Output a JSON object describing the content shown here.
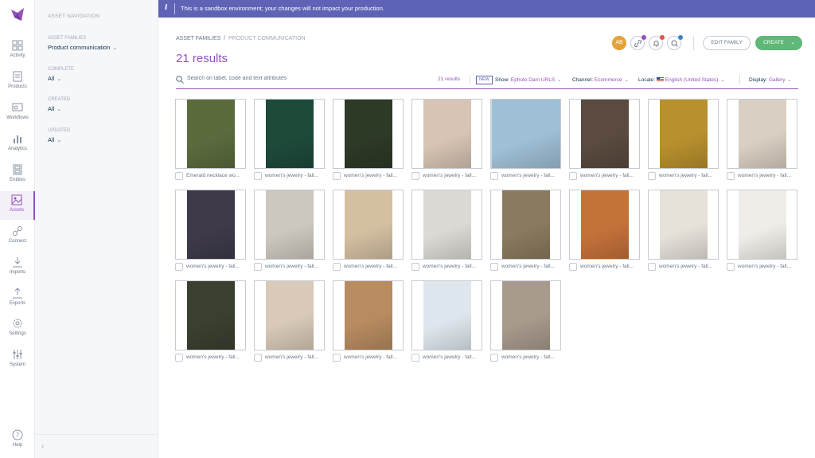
{
  "banner": {
    "text": "This is a sandbox environment; your changes will not impact your production."
  },
  "mainnav": {
    "items": [
      {
        "label": "Activity",
        "icon": "activity-icon"
      },
      {
        "label": "Products",
        "icon": "products-icon"
      },
      {
        "label": "Workflows",
        "icon": "workflows-icon"
      },
      {
        "label": "Analytics",
        "icon": "analytics-icon"
      },
      {
        "label": "Entities",
        "icon": "entities-icon"
      },
      {
        "label": "Assets",
        "icon": "assets-icon",
        "active": true
      },
      {
        "label": "Connect",
        "icon": "connect-icon"
      },
      {
        "label": "Imports",
        "icon": "imports-icon"
      },
      {
        "label": "Exports",
        "icon": "exports-icon"
      },
      {
        "label": "Settings",
        "icon": "settings-icon"
      },
      {
        "label": "System",
        "icon": "system-icon"
      }
    ],
    "help": "Help"
  },
  "subnav": {
    "title": "ASSET NAVIGATION",
    "family_label": "ASSET FAMILIES",
    "family_value": "Product communication",
    "complete_label": "COMPLETE",
    "complete_value": "All",
    "created_label": "CREATED",
    "created_value": "All",
    "updated_label": "UPDATED",
    "updated_value": "All"
  },
  "header": {
    "breadcrumb_root": "ASSET FAMILIES",
    "breadcrumb_sep": "/",
    "breadcrumb_current": "PRODUCT COMMUNICATION",
    "results": "21 results",
    "avatar": "AB",
    "edit_family": "EDIT FAMILY",
    "create": "CREATE"
  },
  "search": {
    "placeholder": "Search on label, code and text attributes",
    "count": "21 results",
    "new_badge": "NEW",
    "show_label": "Show:",
    "show_value": "Ephoto Dam URLS",
    "channel_label": "Channel:",
    "channel_value": "Ecommerce",
    "locale_label": "Locale:",
    "locale_value": "English (United States)",
    "display_label": "Display:",
    "display_value": "Gallery"
  },
  "colors": {
    "accent": "#9452ba",
    "banner": "#5e63b6",
    "create": "#5fb878"
  },
  "assets": [
    {
      "caption": "Emerald necklace wo...",
      "bg": "#5b6b3e"
    },
    {
      "caption": "women's jewelry - fall...",
      "bg": "#1e4a3a"
    },
    {
      "caption": "women's jewelry - fall...",
      "bg": "#2d3a26"
    },
    {
      "caption": "women's jewelry - fall...",
      "bg": "#d7c4b4"
    },
    {
      "caption": "women's jewelry - fall...",
      "bg": "#9fc0d6"
    },
    {
      "caption": "women's jewelry - fall...",
      "bg": "#5a4a3f"
    },
    {
      "caption": "women's jewelry - fall...",
      "bg": "#b8902d"
    },
    {
      "caption": "women's jewelry - fall...",
      "bg": "#d9cfc2"
    },
    {
      "caption": "women's jewelry - fall...",
      "bg": "#3e3a4a"
    },
    {
      "caption": "women's jewelry - fall...",
      "bg": "#cdc8bf"
    },
    {
      "caption": "women's jewelry - fall...",
      "bg": "#d4bfa1"
    },
    {
      "caption": "women's jewelry - fall...",
      "bg": "#dcdad4"
    },
    {
      "caption": "women's jewelry - fall...",
      "bg": "#8a7a5e"
    },
    {
      "caption": "women's jewelry - fall...",
      "bg": "#c4713a"
    },
    {
      "caption": "women's jewelry - fall...",
      "bg": "#e6e2da"
    },
    {
      "caption": "women's jewelry - fall...",
      "bg": "#f0ede8"
    },
    {
      "caption": "women's jewelry - fall...",
      "bg": "#3a4030"
    },
    {
      "caption": "women's jewelry - fall...",
      "bg": "#d8c9b8"
    },
    {
      "caption": "women's jewelry - fall...",
      "bg": "#b88b60"
    },
    {
      "caption": "women's jewelry - fall...",
      "bg": "#dfe7ee"
    },
    {
      "caption": "women's jewelry - fall...",
      "bg": "#a89a8c"
    }
  ]
}
